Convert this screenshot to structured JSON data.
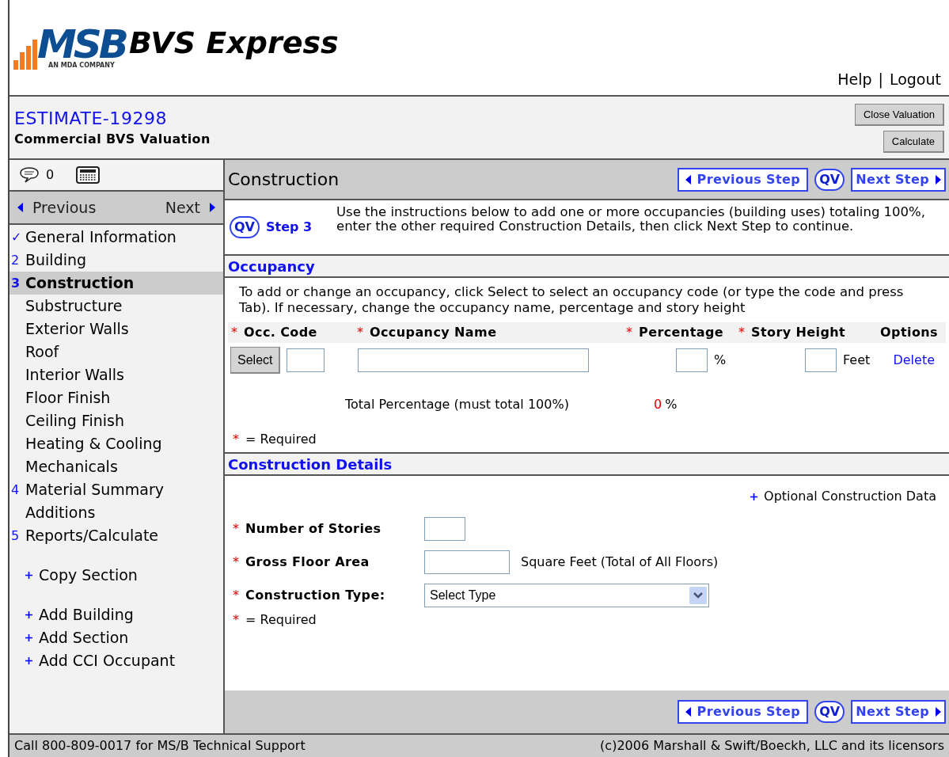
{
  "header": {
    "logo": "MSB",
    "logo_tagline": "AN MDA COMPANY",
    "product": "BVS Express",
    "links": [
      "Help",
      "Logout"
    ],
    "separator": "|"
  },
  "estimate": {
    "title": "ESTIMATE-19298",
    "subtitle": "Commercial BVS Valuation",
    "buttons": [
      "Close Valuation",
      "Calculate"
    ]
  },
  "sidebar": {
    "comment_count": "0",
    "prev": "Previous",
    "next": "Next",
    "items": [
      {
        "marker": "✓",
        "label": "General Information",
        "selected": false
      },
      {
        "marker": "2",
        "label": "Building",
        "selected": false
      },
      {
        "marker": "3",
        "label": "Construction",
        "selected": true,
        "children": [
          {
            "label": "Substructure",
            "selected": false
          },
          {
            "label": "Exterior Walls",
            "selected": false
          },
          {
            "label": "Roof",
            "selected": false
          },
          {
            "label": "Interior Walls",
            "selected": false
          },
          {
            "label": "Floor Finish",
            "selected": false
          },
          {
            "label": "Ceiling Finish",
            "selected": false
          },
          {
            "label": "Heating & Cooling",
            "selected": false
          },
          {
            "label": "Mechanicals",
            "selected": false
          }
        ]
      },
      {
        "marker": "4",
        "label": "Material Summary",
        "selected": false,
        "children": [
          {
            "label": "Additions",
            "selected": false
          }
        ]
      },
      {
        "marker": "5",
        "label": "Reports/Calculate",
        "selected": false
      }
    ],
    "action_groups": [
      [
        "Copy Section"
      ],
      [
        "Add Building",
        "Add Section",
        "Add CCI Occupant"
      ]
    ]
  },
  "main": {
    "title": "Construction",
    "step_navs": [
      {
        "prev": "Previous Step",
        "qv": "QV",
        "next": "Next Step"
      },
      {
        "prev": "Previous Step",
        "qv": "QV",
        "next": "Next Step"
      }
    ],
    "step": {
      "qv": "QV",
      "label": "Step 3",
      "text": "Use the instructions below to add one or more occupancies (building uses) totaling 100%, enter the other required Construction Details, then click Next Step to continue."
    },
    "required_mark": "*",
    "occupancy": {
      "heading": "Occupancy",
      "instructions": "To add or change an occupancy, click Select to select an occupancy code (or type the code and press Tab). If necessary, change the occupancy name, percentage and story height",
      "columns": [
        {
          "label": "Occ. Code",
          "required": true
        },
        {
          "label": "Occupancy Name",
          "required": true
        },
        {
          "label": "Percentage",
          "required": true
        },
        {
          "label": "Story Height",
          "required": true
        },
        {
          "label": "Options",
          "required": false
        }
      ],
      "row": {
        "select": "Select",
        "percent_unit": "%",
        "height_unit": "Feet",
        "delete": "Delete"
      },
      "total_label": "Total Percentage (must total 100%)",
      "total_value": "0",
      "total_unit": "%",
      "required_note": "= Required"
    },
    "details": {
      "heading": "Construction Details",
      "optional_link": "Optional Construction Data",
      "fields": [
        {
          "kind": "text",
          "label": "Number of Stories",
          "required": true
        },
        {
          "kind": "area",
          "label": "Gross Floor Area",
          "required": true,
          "unit": "Square Feet (Total of All Floors)"
        },
        {
          "kind": "select",
          "label": "Construction Type:",
          "required": true,
          "value": "Select Type"
        }
      ],
      "required_note": "= Required"
    }
  },
  "footer": {
    "left": "Call 800-809-0017 for MS/B Technical Support",
    "right": "(c)2006 Marshall & Swift/Boeckh, LLC and its licensors"
  }
}
